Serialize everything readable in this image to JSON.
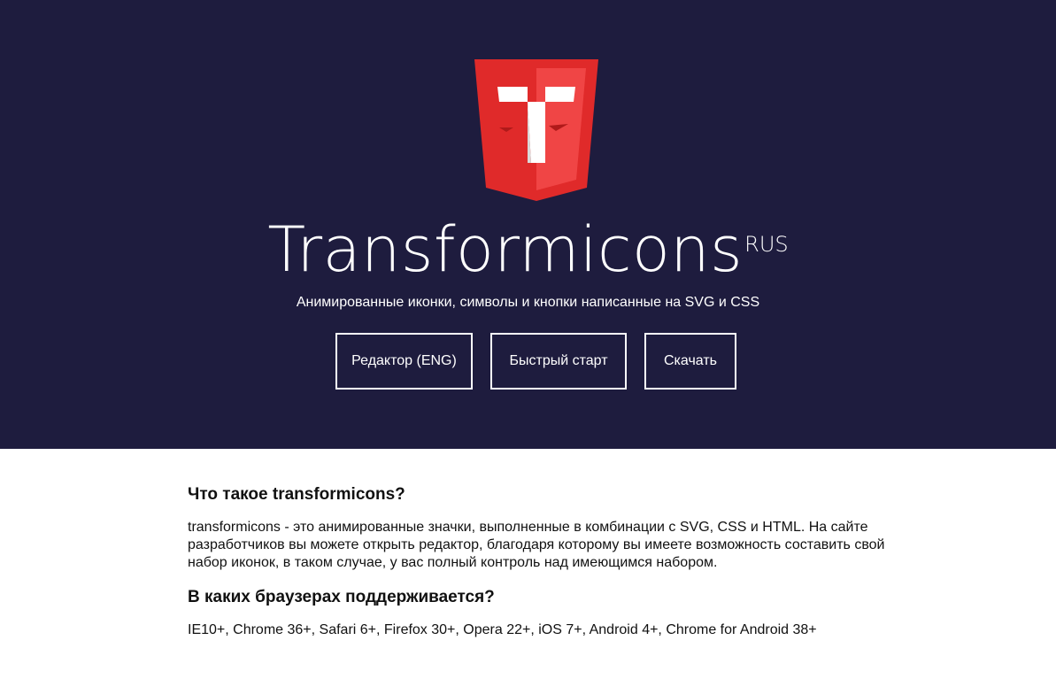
{
  "header": {
    "title": "Transformicons",
    "title_sup": "RUS",
    "tagline": "Анимированные иконки, символы и кнопки написанные на SVG и CSS",
    "logo_icon": "transformicons-shield-logo",
    "colors": {
      "background": "#1e1c3e",
      "logo_red": "#e02a2a",
      "logo_red_light": "#f04545"
    }
  },
  "buttons": {
    "editor": "Редактор (ENG)",
    "quick_start": "Быстрый старт",
    "download": "Скачать"
  },
  "content": {
    "section1": {
      "heading": "Что такое transformicons?",
      "text": "transformicons - это анимированные значки, выполненные в комбинации с SVG, CSS и HTML. На сайте разработчиков вы можете открыть редактор, благодаря которому вы имеете возможность составить свой набор иконок, в таком случае, у вас полный контроль над имеющимся набором."
    },
    "section2": {
      "heading": "В каких браузерах поддерживается?",
      "text": "IE10+, Chrome 36+, Safari 6+, Firefox 30+, Opera 22+, iOS 7+, Android 4+, Chrome for Android 38+"
    }
  }
}
